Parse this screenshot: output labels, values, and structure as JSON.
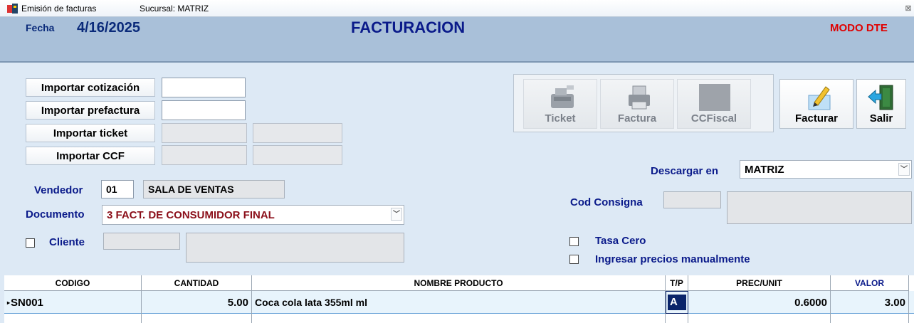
{
  "window": {
    "title": "Emisión de facturas",
    "branch": "Sucursal: MATRIZ",
    "close_glyph": "⊠"
  },
  "header": {
    "date_label": "Fecha",
    "date_value": "4/16/2025",
    "title": "FACTURACION",
    "mode": "MODO DTE"
  },
  "imports": {
    "cotizacion_label": "Importar cotización",
    "prefactura_label": "Importar prefactura",
    "ticket_label": "Importar ticket",
    "ccf_label": "Importar CCF"
  },
  "form": {
    "vendedor_label": "Vendedor",
    "vendedor_code": "01",
    "vendedor_name": "SALA DE VENTAS",
    "documento_label": "Documento",
    "documento_value": "3  FACT. DE CONSUMIDOR FINAL",
    "cliente_label": "Cliente",
    "descargar_label": "Descargar en",
    "descargar_value": "MATRIZ",
    "consigna_label": "Cod Consigna",
    "tasa_cero_label": "Tasa Cero",
    "manual_prices_label": "Ingresar precios manualmente"
  },
  "toolbar": {
    "ticket_label": "Ticket",
    "factura_label": "Factura",
    "ccfiscal_label": "CCFiscal",
    "facturar_label": "Facturar",
    "salir_label": "Salir"
  },
  "grid": {
    "columns": [
      "CODIGO",
      "CANTIDAD",
      "NOMBRE PRODUCTO",
      "T/P",
      "PREC/UNIT",
      "VALOR"
    ],
    "rows": [
      {
        "codigo": "SN001",
        "cantidad": "5.00",
        "nombre": "Coca cola lata 355ml ml",
        "tp": "A",
        "precio": "0.6000",
        "valor": "3.00"
      }
    ]
  },
  "colors": {
    "header_bg": "#a9c0d9",
    "label_blue": "#0a1a8a",
    "mode_red": "#e00000",
    "selected_cell": "#0a246a"
  }
}
